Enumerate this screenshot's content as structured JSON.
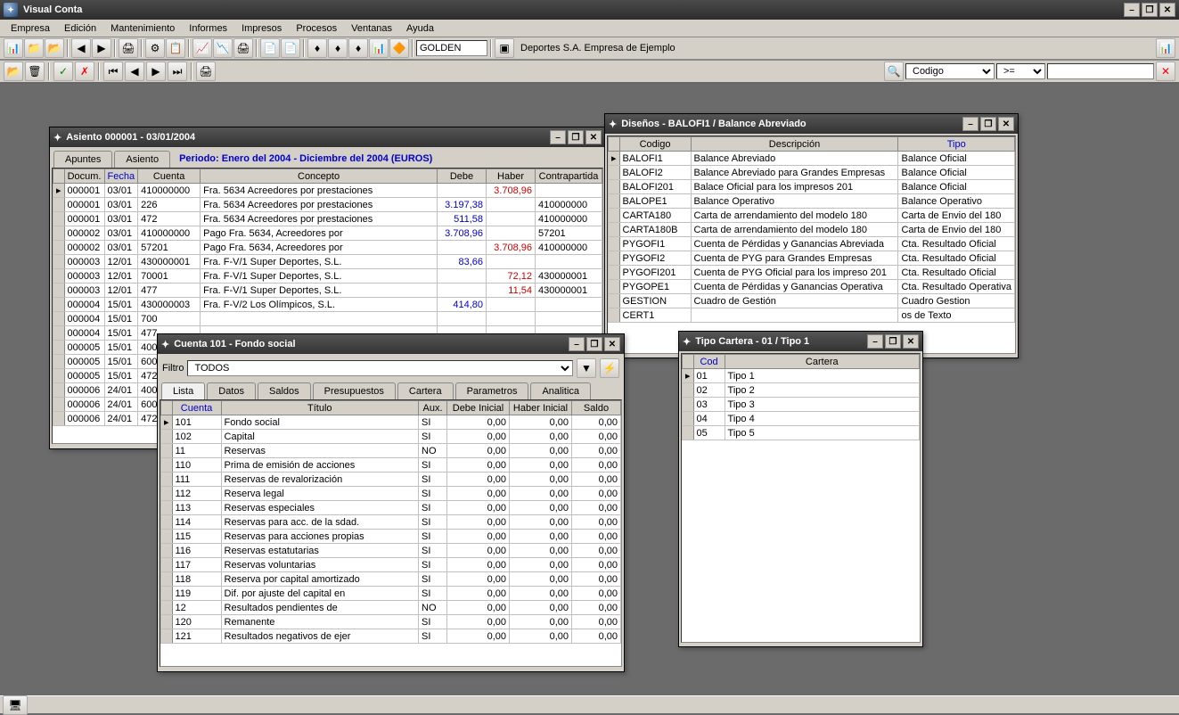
{
  "app": {
    "title": "Visual Conta"
  },
  "menu": [
    "Empresa",
    "Edición",
    "Mantenimiento",
    "Informes",
    "Impresos",
    "Procesos",
    "Ventanas",
    "Ayuda"
  ],
  "toolbar": {
    "code_input": "GOLDEN",
    "company_label": "Deportes S.A. Empresa de Ejemplo",
    "search_field": "Codigo",
    "search_op": ">="
  },
  "asiento": {
    "title": "Asiento 000001 - 03/01/2004",
    "tab_apuntes": "Apuntes",
    "tab_asiento": "Asiento",
    "period": "Periodo: Enero del 2004 - Diciembre del 2004  (EUROS)",
    "cols": {
      "docum": "Docum.",
      "fecha": "Fecha",
      "cuenta": "Cuenta",
      "concepto": "Concepto",
      "debe": "Debe",
      "haber": "Haber",
      "contra": "Contrapartida"
    },
    "rows": [
      {
        "d": "000001",
        "f": "03/01",
        "c": "410000000",
        "con": "Fra. 5634 Acreedores por prestaciones",
        "debe": "",
        "haber": "3.708,96",
        "contra": ""
      },
      {
        "d": "000001",
        "f": "03/01",
        "c": "226",
        "con": "Fra. 5634 Acreedores por prestaciones",
        "debe": "3.197,38",
        "haber": "",
        "contra": "410000000"
      },
      {
        "d": "000001",
        "f": "03/01",
        "c": "472",
        "con": "Fra. 5634 Acreedores por prestaciones",
        "debe": "511,58",
        "haber": "",
        "contra": "410000000"
      },
      {
        "d": "000002",
        "f": "03/01",
        "c": "410000000",
        "con": "Pago Fra. 5634, Acreedores por",
        "debe": "3.708,96",
        "haber": "",
        "contra": "57201"
      },
      {
        "d": "000002",
        "f": "03/01",
        "c": "57201",
        "con": "Pago Fra. 5634, Acreedores por",
        "debe": "",
        "haber": "3.708,96",
        "contra": "410000000"
      },
      {
        "d": "000003",
        "f": "12/01",
        "c": "430000001",
        "con": "Fra. F-V/1 Super Deportes, S.L.",
        "debe": "83,66",
        "haber": "",
        "contra": ""
      },
      {
        "d": "000003",
        "f": "12/01",
        "c": "70001",
        "con": "Fra. F-V/1 Super Deportes, S.L.",
        "debe": "",
        "haber": "72,12",
        "contra": "430000001"
      },
      {
        "d": "000003",
        "f": "12/01",
        "c": "477",
        "con": "Fra. F-V/1 Super Deportes, S.L.",
        "debe": "",
        "haber": "11,54",
        "contra": "430000001"
      },
      {
        "d": "000004",
        "f": "15/01",
        "c": "430000003",
        "con": "Fra. F-V/2 Los Olímpicos, S.L.",
        "debe": "414,80",
        "haber": "",
        "contra": ""
      },
      {
        "d": "000004",
        "f": "15/01",
        "c": "700",
        "con": "",
        "debe": "",
        "haber": "",
        "contra": ""
      },
      {
        "d": "000004",
        "f": "15/01",
        "c": "477",
        "con": "",
        "debe": "",
        "haber": "",
        "contra": ""
      },
      {
        "d": "000005",
        "f": "15/01",
        "c": "400",
        "con": "",
        "debe": "",
        "haber": "",
        "contra": ""
      },
      {
        "d": "000005",
        "f": "15/01",
        "c": "600",
        "con": "",
        "debe": "",
        "haber": "",
        "contra": ""
      },
      {
        "d": "000005",
        "f": "15/01",
        "c": "472",
        "con": "",
        "debe": "",
        "haber": "",
        "contra": ""
      },
      {
        "d": "000006",
        "f": "24/01",
        "c": "400",
        "con": "",
        "debe": "",
        "haber": "",
        "contra": ""
      },
      {
        "d": "000006",
        "f": "24/01",
        "c": "600",
        "con": "",
        "debe": "",
        "haber": "",
        "contra": ""
      },
      {
        "d": "000006",
        "f": "24/01",
        "c": "472",
        "con": "",
        "debe": "",
        "haber": "",
        "contra": ""
      }
    ]
  },
  "disenos": {
    "title": "Diseños - BALOFI1 / Balance Abreviado",
    "cols": {
      "codigo": "Codigo",
      "desc": "Descripción",
      "tipo": "Tipo"
    },
    "rows": [
      {
        "c": "BALOFI1",
        "d": "Balance Abreviado",
        "t": "Balance Oficial"
      },
      {
        "c": "BALOFI2",
        "d": "Balance Abreviado para Grandes Empresas",
        "t": "Balance Oficial"
      },
      {
        "c": "BALOFI201",
        "d": "Balace Oficial para los impresos 201",
        "t": "Balance Oficial"
      },
      {
        "c": "BALOPE1",
        "d": "Balance Operativo",
        "t": "Balance Operativo"
      },
      {
        "c": "CARTA180",
        "d": "Carta de arrendamiento del modelo 180",
        "t": "Carta de Envio del 180"
      },
      {
        "c": "CARTA180B",
        "d": "Carta de arrendamiento del modelo 180",
        "t": "Carta de Envio del 180"
      },
      {
        "c": "PYGOFI1",
        "d": "Cuenta de Pérdidas y Ganancias Abreviada",
        "t": "Cta. Resultado Oficial"
      },
      {
        "c": "PYGOFI2",
        "d": "Cuenta de PYG para Grandes Empresas",
        "t": "Cta. Resultado Oficial"
      },
      {
        "c": "PYGOFI201",
        "d": "Cuenta de PYG Oficial para los impreso 201",
        "t": "Cta. Resultado Oficial"
      },
      {
        "c": "PYGOPE1",
        "d": "Cuenta de Pérdidas y Ganancias Operativa",
        "t": "Cta. Resultado Operativa"
      },
      {
        "c": "GESTION",
        "d": "Cuadro de Gestión",
        "t": "Cuadro Gestion"
      },
      {
        "c": "CERT1",
        "d": "",
        "t": "os de Texto"
      }
    ]
  },
  "cuenta": {
    "title": "Cuenta 101 - Fondo social",
    "filter_label": "Filtro",
    "filter_value": "TODOS",
    "tabs": [
      "Lista",
      "Datos",
      "Saldos",
      "Presupuestos",
      "Cartera",
      "Parametros",
      "Analitica"
    ],
    "cols": {
      "cuenta": "Cuenta",
      "titulo": "Título",
      "aux": "Aux.",
      "di": "Debe Inicial",
      "hi": "Haber Inicial",
      "saldo": "Saldo"
    },
    "rows": [
      {
        "c": "101",
        "t": "Fondo social",
        "a": "SI",
        "di": "0,00",
        "hi": "0,00",
        "s": "0,00"
      },
      {
        "c": "102",
        "t": "Capital",
        "a": "SI",
        "di": "0,00",
        "hi": "0,00",
        "s": "0,00"
      },
      {
        "c": "11",
        "t": "Reservas",
        "a": "NO",
        "di": "0,00",
        "hi": "0,00",
        "s": "0,00"
      },
      {
        "c": "110",
        "t": "Prima de emisión de acciones",
        "a": "SI",
        "di": "0,00",
        "hi": "0,00",
        "s": "0,00"
      },
      {
        "c": "111",
        "t": "Reservas de revalorización",
        "a": "SI",
        "di": "0,00",
        "hi": "0,00",
        "s": "0,00"
      },
      {
        "c": "112",
        "t": "Reserva legal",
        "a": "SI",
        "di": "0,00",
        "hi": "0,00",
        "s": "0,00"
      },
      {
        "c": "113",
        "t": "Reservas especiales",
        "a": "SI",
        "di": "0,00",
        "hi": "0,00",
        "s": "0,00"
      },
      {
        "c": "114",
        "t": "Reservas para acc. de la sdad.",
        "a": "SI",
        "di": "0,00",
        "hi": "0,00",
        "s": "0,00"
      },
      {
        "c": "115",
        "t": "Reservas para acciones propias",
        "a": "SI",
        "di": "0,00",
        "hi": "0,00",
        "s": "0,00"
      },
      {
        "c": "116",
        "t": "Reservas estatutarias",
        "a": "SI",
        "di": "0,00",
        "hi": "0,00",
        "s": "0,00"
      },
      {
        "c": "117",
        "t": "Reservas voluntarias",
        "a": "SI",
        "di": "0,00",
        "hi": "0,00",
        "s": "0,00"
      },
      {
        "c": "118",
        "t": "Reserva por capital amortizado",
        "a": "SI",
        "di": "0,00",
        "hi": "0,00",
        "s": "0,00"
      },
      {
        "c": "119",
        "t": "Dif. por ajuste del capital en",
        "a": "SI",
        "di": "0,00",
        "hi": "0,00",
        "s": "0,00"
      },
      {
        "c": "12",
        "t": "Resultados pendientes de",
        "a": "NO",
        "di": "0,00",
        "hi": "0,00",
        "s": "0,00"
      },
      {
        "c": "120",
        "t": "Remanente",
        "a": "SI",
        "di": "0,00",
        "hi": "0,00",
        "s": "0,00"
      },
      {
        "c": "121",
        "t": "Resultados negativos de ejer",
        "a": "SI",
        "di": "0,00",
        "hi": "0,00",
        "s": "0,00"
      }
    ]
  },
  "cartera": {
    "title": "Tipo Cartera - 01 / Tipo 1",
    "cols": {
      "cod": "Cod",
      "cartera": "Cartera"
    },
    "rows": [
      {
        "c": "01",
        "n": "Tipo 1"
      },
      {
        "c": "02",
        "n": "Tipo 2"
      },
      {
        "c": "03",
        "n": "Tipo 3"
      },
      {
        "c": "04",
        "n": "Tipo 4"
      },
      {
        "c": "05",
        "n": "Tipo 5"
      }
    ]
  }
}
